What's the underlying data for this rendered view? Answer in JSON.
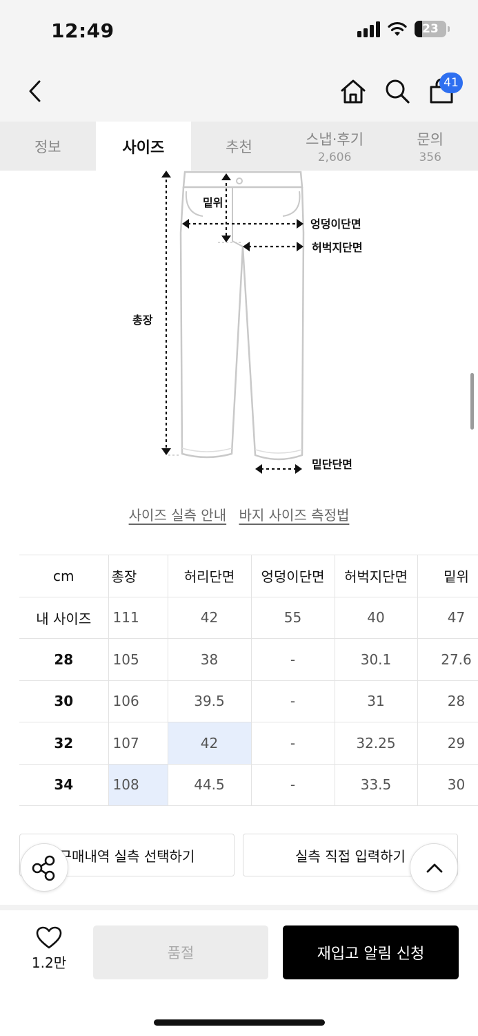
{
  "status_bar": {
    "time": "12:49",
    "battery": "23",
    "battery_level_percent": 23
  },
  "nav": {
    "back_icon": "chevron-left-icon",
    "home_icon": "home-icon",
    "search_icon": "search-icon",
    "bag_icon": "shopping-bag-icon",
    "bag_badge": "41"
  },
  "tabs": [
    {
      "label": "정보",
      "count": ""
    },
    {
      "label": "사이즈",
      "count": ""
    },
    {
      "label": "추천",
      "count": ""
    },
    {
      "label": "스냅·후기",
      "count": "2,606"
    },
    {
      "label": "문의",
      "count": "356"
    }
  ],
  "diagram": {
    "rise": "밑위",
    "hip": "엉덩이단면",
    "thigh": "허벅지단면",
    "length": "총장",
    "hem": "밑단단면"
  },
  "links": {
    "guide": "사이즈 실측 안내",
    "howto": "바지 사이즈 측정법"
  },
  "size_table": {
    "headers": [
      "cm",
      "총장",
      "허리단면",
      "엉덩이단면",
      "허벅지단면",
      "밑위"
    ],
    "rows": [
      {
        "size": "내 사이즈",
        "values": [
          "111",
          "42",
          "55",
          "40",
          "47"
        ]
      },
      {
        "size": "28",
        "values": [
          "105",
          "38",
          "-",
          "30.1",
          "27.6"
        ]
      },
      {
        "size": "30",
        "values": [
          "106",
          "39.5",
          "-",
          "31",
          "28"
        ]
      },
      {
        "size": "32",
        "values": [
          "107",
          "42",
          "-",
          "32.25",
          "29"
        ]
      },
      {
        "size": "34",
        "values": [
          "108",
          "44.5",
          "-",
          "33.5",
          "30"
        ]
      }
    ],
    "highlight_color": "#e6eefc"
  },
  "actions": {
    "purchase_history": "구매내역 실측 선택하기",
    "manual_input": "실측 직접 입력하기",
    "share_icon": "share-icon",
    "scroll_top_icon": "chevron-up-icon"
  },
  "bottom_bar": {
    "like_icon": "heart-icon",
    "like_count": "1.2만",
    "soldout_label": "품절",
    "restock_label": "재입고 알림 신청"
  },
  "colors": {
    "accent": "#2e6ff0",
    "primary_button": "#000000",
    "disabled_button": "#ececec"
  }
}
